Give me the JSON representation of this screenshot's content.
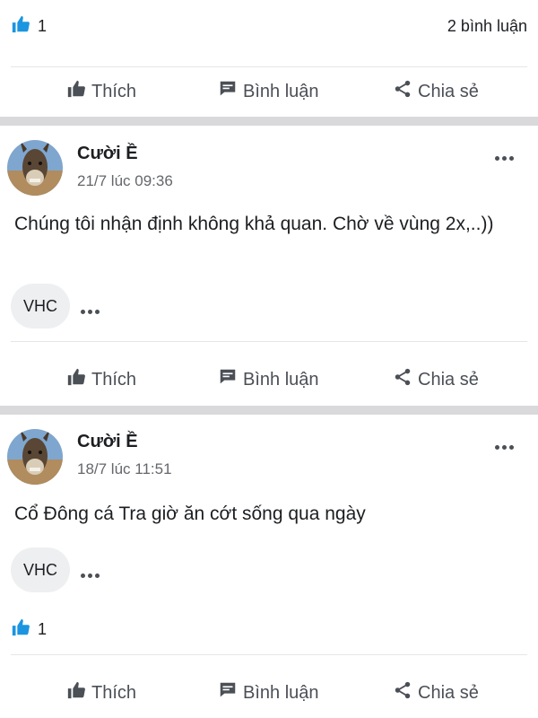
{
  "colors": {
    "accent_like": "#1b95e0",
    "separator": "#d9d9db",
    "text_muted": "#65676b"
  },
  "top_reactions": {
    "like_count": "1",
    "comments": "2 bình luận"
  },
  "actions": {
    "like": "Thích",
    "comment": "Bình luận",
    "share": "Chia sẻ"
  },
  "posts": [
    {
      "author": "Cười Ề",
      "time": "21/7 lúc 09:36",
      "text": "Chúng tôi nhận định không khả quan. Chờ về vùng 2x,..))",
      "tag": "VHC"
    },
    {
      "author": "Cười Ề",
      "time": "18/7 lúc 11:51",
      "text": "Cổ Đông cá Tra giờ ăn cớt sống qua ngày",
      "tag": "VHC",
      "like_count": "1"
    }
  ],
  "icons": [
    "like-icon",
    "thumbs-up-icon",
    "comment-icon",
    "share-icon",
    "more-dots-icon",
    "avatar-donkey"
  ]
}
